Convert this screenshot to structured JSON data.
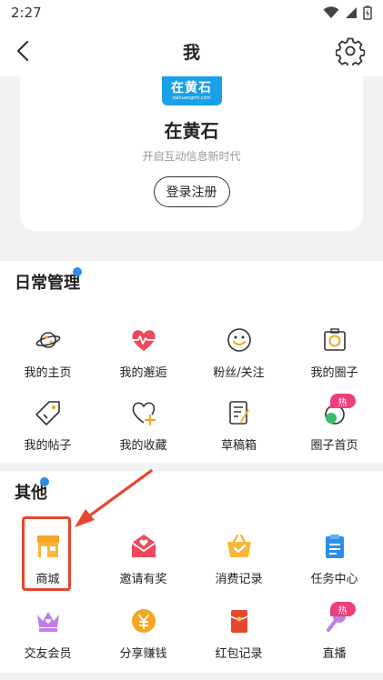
{
  "status": {
    "time": "2:27"
  },
  "nav": {
    "title": "我"
  },
  "profile": {
    "logo_text": "在黄石",
    "logo_sub": "zaihuangshi.com",
    "app_name": "在黄石",
    "slogan": "开启互动信息新时代",
    "login_label": "登录注册"
  },
  "daily": {
    "title": "日常管理",
    "items": [
      {
        "label": "我的主页",
        "icon": "planet-icon"
      },
      {
        "label": "我的邂逅",
        "icon": "heartbeat-icon"
      },
      {
        "label": "粉丝/关注",
        "icon": "smile-icon"
      },
      {
        "label": "我的圈子",
        "icon": "camera-icon"
      },
      {
        "label": "我的帖子",
        "icon": "tag-icon"
      },
      {
        "label": "我的收藏",
        "icon": "heart-plus-icon"
      },
      {
        "label": "草稿箱",
        "icon": "draft-icon"
      },
      {
        "label": "圈子首页",
        "icon": "chat-icon",
        "badge": "热"
      }
    ]
  },
  "other": {
    "title": "其他",
    "items": [
      {
        "label": "商城",
        "icon": "shop-icon"
      },
      {
        "label": "邀请有奖",
        "icon": "envelope-icon"
      },
      {
        "label": "消费记录",
        "icon": "basket-icon"
      },
      {
        "label": "任务中心",
        "icon": "clipboard-icon"
      },
      {
        "label": "交友会员",
        "icon": "crown-icon"
      },
      {
        "label": "分享赚钱",
        "icon": "coin-icon"
      },
      {
        "label": "红包记录",
        "icon": "red-packet-icon"
      },
      {
        "label": "直播",
        "icon": "mic-icon",
        "badge": "热"
      }
    ]
  },
  "colors": {
    "accent_red": "#e8452f",
    "blue": "#2a8fe6",
    "pink": "#ee3f7a",
    "orange": "#f5a623"
  }
}
